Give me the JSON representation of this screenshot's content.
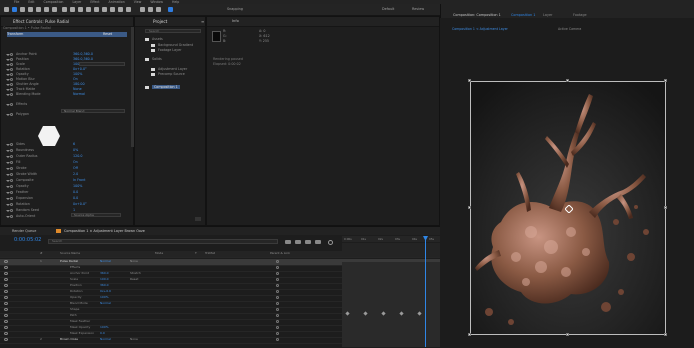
{
  "menu": [
    "File",
    "Edit",
    "Composition",
    "Layer",
    "Effect",
    "Animation",
    "View",
    "Window",
    "Help"
  ],
  "toolbar": {
    "snapping_label": "Snapping",
    "workspaces": [
      "Default",
      "Review",
      "Learn",
      "Standard",
      "Small Screen"
    ],
    "search_placeholder": "Search Help"
  },
  "effect_controls": {
    "tab_title": "Effect Controls: Pulse Radial",
    "heading": "Pulse Radial",
    "breadcrumb": "Composition 1 • Pulse Radial",
    "rows": [
      {
        "label": "Transform",
        "value": "Reset",
        "highlight": true
      },
      {
        "label": "Anchor Point",
        "value": "360.0,360.0"
      },
      {
        "label": "Position",
        "value": "360.0,360.0"
      },
      {
        "label": "Scale",
        "value": "100.0,100.0 %"
      },
      {
        "label": "Rotation",
        "value": "0x+0.0°"
      },
      {
        "label": "Opacity",
        "value": "100%"
      },
      {
        "label": "Motion Blur",
        "value": "On"
      },
      {
        "label": "Shutter Angle",
        "value": "180.00"
      },
      {
        "label": "Track Matte",
        "value": "None"
      },
      {
        "label": "Blending Mode",
        "value": "Normal"
      },
      {
        "label": "Effects",
        "value": ""
      },
      {
        "label": "Polygon",
        "value": ""
      },
      {
        "label": "Sides",
        "value": "6"
      },
      {
        "label": "Roundness",
        "value": "0%"
      },
      {
        "label": "Outer Radius",
        "value": "120.0"
      },
      {
        "label": "Fill",
        "value": "On"
      },
      {
        "label": "Stroke",
        "value": "Off"
      },
      {
        "label": "Stroke Width",
        "value": "2.0"
      },
      {
        "label": "Composite",
        "value": "In Front"
      },
      {
        "label": "Opacity",
        "value": "100%"
      },
      {
        "label": "Feather",
        "value": "0.0"
      },
      {
        "label": "Expansion",
        "value": "0.0"
      },
      {
        "label": "Rotation",
        "value": "0x+0.0°"
      },
      {
        "label": "Random Seed",
        "value": "1"
      },
      {
        "label": "Auto-Orient",
        "value": "Off"
      }
    ],
    "color_dropdown": "Normal Blend",
    "composite_dropdown": "Source Alpha"
  },
  "project": {
    "tab_title": "Project",
    "search_placeholder": "Search",
    "items": [
      {
        "name": "Assets"
      },
      {
        "name": "Background Gradient"
      },
      {
        "name": "Footage Layer"
      },
      {
        "name": "Solids"
      },
      {
        "name": "Adjustment Layer"
      },
      {
        "name": "Precomp Source"
      },
      {
        "name": "Composition 1",
        "selected": true
      }
    ]
  },
  "info": {
    "tab_title": "Info",
    "lines": [
      "R:",
      "G:",
      "B:",
      "A: 0",
      "X: 612",
      "Y: 255"
    ],
    "footer": [
      "Rendering paused",
      "Elapsed: 0:00:02"
    ]
  },
  "composition_viewer": {
    "tab_title": "Composition: Composition 1",
    "tabs": [
      "Composition 1",
      "Layer",
      "Footage"
    ],
    "subtitle": "Composition 1 < Adjustment Layer",
    "zoom": "Full",
    "quality": "Half",
    "resolution_label": "Active Camera"
  },
  "timeline": {
    "tab_title": "Render Queue",
    "comp_tab": "Composition 1 × Adjustment Layer Brown Ooze",
    "timecode": "0:00:05:02",
    "search_placeholder": "Search",
    "columns": [
      "#",
      "Source Name",
      "Mode",
      "T",
      "TrkMat",
      "Parent & Link"
    ],
    "ruler_ticks": [
      "0:00s",
      "01s",
      "02s",
      "03s",
      "04s",
      "05s"
    ],
    "layers": [
      {
        "num": "1",
        "name": "Pulse Radial",
        "mode": "Normal",
        "parent": "None",
        "selected": true
      },
      {
        "num": "",
        "name": "Effects",
        "mode": "",
        "parent": ""
      },
      {
        "num": "",
        "name": "Anchor Point",
        "mode": "360.0",
        "parent": "Stretch"
      },
      {
        "num": "",
        "name": "Scale",
        "mode": "100.0",
        "parent": "Reset"
      },
      {
        "num": "",
        "name": "Position",
        "mode": "360.0",
        "parent": ""
      },
      {
        "num": "",
        "name": "Rotation",
        "mode": "0x+0.0",
        "parent": ""
      },
      {
        "num": "",
        "name": "Opacity",
        "mode": "100%",
        "parent": ""
      },
      {
        "num": "",
        "name": "Blend Mode",
        "mode": "Normal",
        "parent": ""
      },
      {
        "num": "",
        "name": "Shape",
        "mode": "",
        "parent": ""
      },
      {
        "num": "",
        "name": "Path",
        "mode": "",
        "parent": ""
      },
      {
        "num": "",
        "name": "Mask Feather",
        "mode": "",
        "parent": ""
      },
      {
        "num": "",
        "name": "Mask Opacity",
        "mode": "100%",
        "parent": ""
      },
      {
        "num": "",
        "name": "Mask Expansion",
        "mode": "0.0",
        "parent": ""
      },
      {
        "num": "2",
        "name": "Brown Ooze",
        "mode": "Normal",
        "parent": "None"
      }
    ]
  },
  "colors": {
    "accent_blue": "#2f86e6",
    "value_blue": "#3e8ee6",
    "panel_bg": "#1e1e1e",
    "ooze_brown": "#8a5a44"
  }
}
